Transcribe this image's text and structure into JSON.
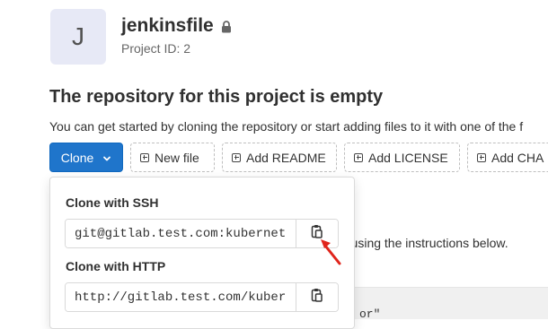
{
  "project": {
    "avatar_letter": "J",
    "name": "jenkinsfile",
    "id_text": "Project ID: 2"
  },
  "empty_state": {
    "title": "The repository for this project is empty",
    "description": "You can get started by cloning the repository or start adding files to it with one of the f"
  },
  "actions": {
    "clone_label": "Clone",
    "new_file_label": "New file",
    "add_readme_label": "Add README",
    "add_license_label": "Add LICENSE",
    "add_changelog_label": "Add CHA"
  },
  "clone_dropdown": {
    "ssh_label": "Clone with SSH",
    "ssh_url": "git@gitlab.test.com:kubernet",
    "http_label": "Clone with HTTP",
    "http_url": "http://gitlab.test.com/kuber"
  },
  "background": {
    "instructions_fragment": "r using the instructions below.",
    "code_fragment": "or\""
  },
  "colors": {
    "primary": "#1f75cb",
    "avatar_bg": "#e7e9f6",
    "cursor": "#e0241b"
  }
}
